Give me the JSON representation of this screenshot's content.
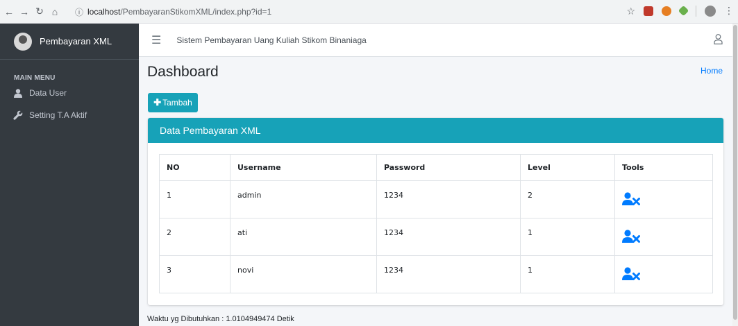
{
  "browser": {
    "url_host": "localhost",
    "url_path": "/PembayaranStikomXML/index.php?id=1"
  },
  "sidebar": {
    "brand": "Pembayaran XML",
    "menu_header": "MAIN MENU",
    "items": [
      {
        "label": "Data User",
        "icon": "user-icon"
      },
      {
        "label": "Setting T.A Aktif",
        "icon": "wrench-icon"
      }
    ]
  },
  "navbar": {
    "title": "Sistem Pembayaran Uang Kuliah Stikom Binaniaga"
  },
  "page": {
    "title": "Dashboard",
    "breadcrumb": "Home",
    "add_button": "Tambah"
  },
  "card": {
    "title": "Data Pembayaran XML"
  },
  "table": {
    "headers": [
      "NO",
      "Username",
      "Password",
      "Level",
      "Tools"
    ],
    "rows": [
      [
        "1",
        "admin",
        "1234",
        "2"
      ],
      [
        "2",
        "ati",
        "1234",
        "1"
      ],
      [
        "3",
        "novi",
        "1234",
        "1"
      ]
    ]
  },
  "footer": {
    "text": "Waktu yg Dibutuhkan : 1.0104949474 Detik"
  },
  "colors": {
    "accent": "#17a2b8",
    "sidebar": "#343a40",
    "link": "#007bff"
  }
}
